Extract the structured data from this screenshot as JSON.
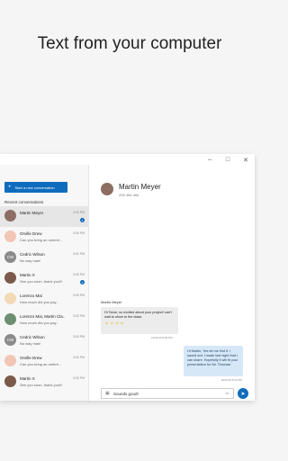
{
  "headline": "Text from your computer",
  "window": {
    "controls": {
      "minimize": "–",
      "maximize": "□",
      "close": "✕"
    }
  },
  "sidebar": {
    "new_conversation_label": "Start a new conversation",
    "recent_label": "Recent conversations",
    "conversations": [
      {
        "name": "Martin Meyer",
        "preview": "",
        "time": "4:00 PM",
        "unread": "1",
        "initials": "",
        "color": "#8d6e63"
      },
      {
        "name": "Orville Drew",
        "preview": "Can you bring an umbrel...",
        "time": "4:00 PM",
        "unread": "",
        "initials": "",
        "color": "#f2c6b5"
      },
      {
        "name": "Cedric Wilson",
        "preview": "No way man!",
        "time": "3:01 PM",
        "unread": "",
        "initials": "CW",
        "color": "#8a8a8a"
      },
      {
        "name": "Martin X",
        "preview": "See you soon, thank you!!!",
        "time": "3:00 PM",
        "unread": "1",
        "initials": "",
        "color": "#7b5a4a"
      },
      {
        "name": "Lorenzo Mai",
        "preview": "How much did you pay...",
        "time": "3:00 PM",
        "unread": "",
        "initials": "",
        "color": "#f3d9b6"
      },
      {
        "name": "Lorenzo Mai, Martin Cla...",
        "preview": "How much did you pay...",
        "time": "3:00 PM",
        "unread": "",
        "initials": "",
        "color": "#6c8f71"
      },
      {
        "name": "Cedric Wilson",
        "preview": "No way man!",
        "time": "3:00 PM",
        "unread": "",
        "initials": "CW",
        "color": "#8a8a8a"
      },
      {
        "name": "Orville Drew",
        "preview": "Can you bring an umbre...",
        "time": "3:00 PM",
        "unread": "",
        "initials": "",
        "color": "#f2c6b5"
      },
      {
        "name": "Martin X",
        "preview": "See you soon, thank you!!!",
        "time": "3:00 PM",
        "unread": "",
        "initials": "",
        "color": "#7b5a4a"
      }
    ]
  },
  "chat": {
    "contact_name": "Martin Meyer",
    "contact_phone": "206 454 4##",
    "incoming_sender": "Martin Meyer",
    "incoming_text": "Hi Taron, so excited about your project! can't wait to show to the class.",
    "incoming_emojis": "☺☺☺☺",
    "incoming_time": "12/22/19 8:00 PM",
    "outgoing_text": "Hi Martin, Yes let me find it. I saved one I made last night that I can share. Hopefully it will fit your presentation for Mr. Thomas!",
    "outgoing_time": "12/22/19 8:10 PM",
    "composer_value": "Sounds good!",
    "icons": {
      "attach": "image-icon",
      "emoji": "emoji-icon",
      "send": "send-icon"
    }
  },
  "colors": {
    "accent": "#0f6cbd",
    "outgoing_bubble": "#d6e8f8",
    "incoming_bubble": "#ececec"
  }
}
